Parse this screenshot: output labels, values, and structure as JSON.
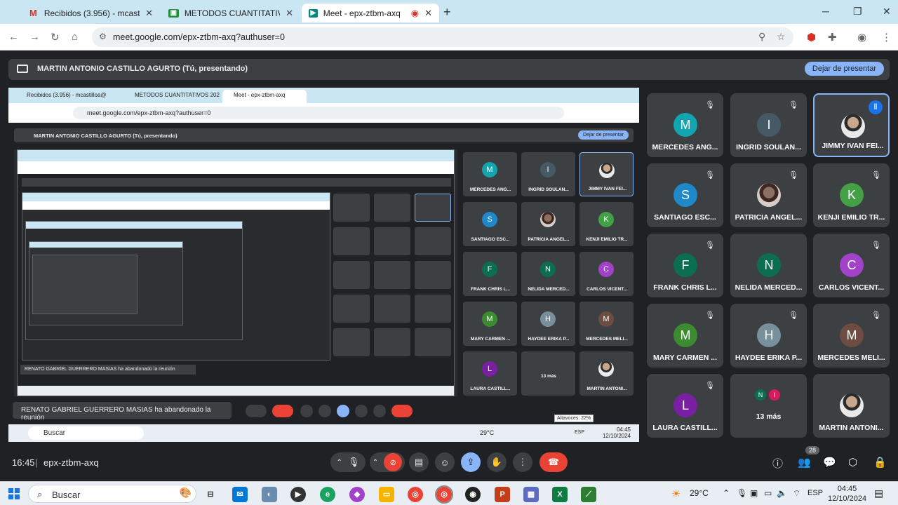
{
  "browser": {
    "tabs": [
      {
        "title": "Recibidos (3.956) - mcastilloa@",
        "icon": "gmail-icon",
        "active": false
      },
      {
        "title": "METODOS CUANTITATIVOS 202",
        "icon": "classroom-icon",
        "active": false
      },
      {
        "title": "Meet - epx-ztbm-axq",
        "icon": "meet-icon",
        "active": true
      }
    ],
    "url": "meet.google.com/epx-ztbm-axq?authuser=0"
  },
  "presenting": {
    "text": "MARTIN ANTONIO CASTILLO AGURTO (Tú, presentando)",
    "stop_label": "Dejar de presentar"
  },
  "shared_screen": {
    "tabs": [
      "Recibidos (3.956) - mcastilloa@",
      "METODOS CUANTITATIVOS 202",
      "Meet - epx-ztbm-axq"
    ],
    "url": "meet.google.com/epx-ztbm-axq?authuser=0",
    "present_text": "MARTIN ANTONIO CASTILLO AGURTO (Tú, presentando)",
    "present_btn": "Dejar de presentar",
    "toast": "RENATO GABRIEL GUERRERO MASIAS ha abandonado la reunión",
    "search": "Buscar",
    "inner_toast": "RENATO GABRIEL GUERRERO MASIAS ha abandonado la reunión",
    "temp": "29°C",
    "time": "04:45",
    "date": "12/10/2024",
    "vol": "Altavoces: 22%",
    "lang": "ESP"
  },
  "participants": [
    {
      "initial": "M",
      "name": "MERCEDES ANG...",
      "color": "#12a4af",
      "muted": true
    },
    {
      "initial": "I",
      "name": "INGRID SOULAN...",
      "color": "#455a64",
      "muted": true
    },
    {
      "initial": "",
      "name": "JIMMY IVAN FEI...",
      "color": "#5f6368",
      "photo": true,
      "speaking": true
    },
    {
      "initial": "S",
      "name": "SANTIAGO ESC...",
      "color": "#1e88c8",
      "muted": true
    },
    {
      "initial": "",
      "name": "PATRICIA ANGEL...",
      "color": "#8d6e63",
      "photo": true,
      "muted": true
    },
    {
      "initial": "K",
      "name": "KENJI EMILIO TR...",
      "color": "#43a047",
      "muted": true
    },
    {
      "initial": "F",
      "name": "FRANK CHRIS L...",
      "color": "#0b6e4f",
      "muted": true
    },
    {
      "initial": "N",
      "name": "NELIDA MERCED...",
      "color": "#0b6e4f",
      "muted": false
    },
    {
      "initial": "C",
      "name": "CARLOS VICENT...",
      "color": "#a142c9",
      "muted": true
    },
    {
      "initial": "M",
      "name": "MARY CARMEN ...",
      "color": "#3d8b2f",
      "muted": true
    },
    {
      "initial": "H",
      "name": "HAYDEE ERIKA P...",
      "color": "#78909c",
      "muted": true
    },
    {
      "initial": "M",
      "name": "MERCEDES MELI...",
      "color": "#6d4c41",
      "muted": true
    },
    {
      "initial": "L",
      "name": "LAURA CASTILL...",
      "color": "#7b1fa2",
      "muted": true
    },
    {
      "initial": "",
      "name": "13 más",
      "more": [
        "N",
        "I"
      ],
      "more_colors": [
        "#0b6e4f",
        "#d81b60"
      ]
    },
    {
      "initial": "",
      "name": "MARTIN ANTONI...",
      "color": "#5f6368",
      "photo": true,
      "muted": false
    }
  ],
  "meeting": {
    "time": "16:45",
    "code": "epx-ztbm-axq",
    "participant_count": "28"
  },
  "taskbar": {
    "search": "Buscar",
    "weather": "29°C",
    "lang": "ESP",
    "time": "04:45",
    "date": "12/10/2024"
  }
}
